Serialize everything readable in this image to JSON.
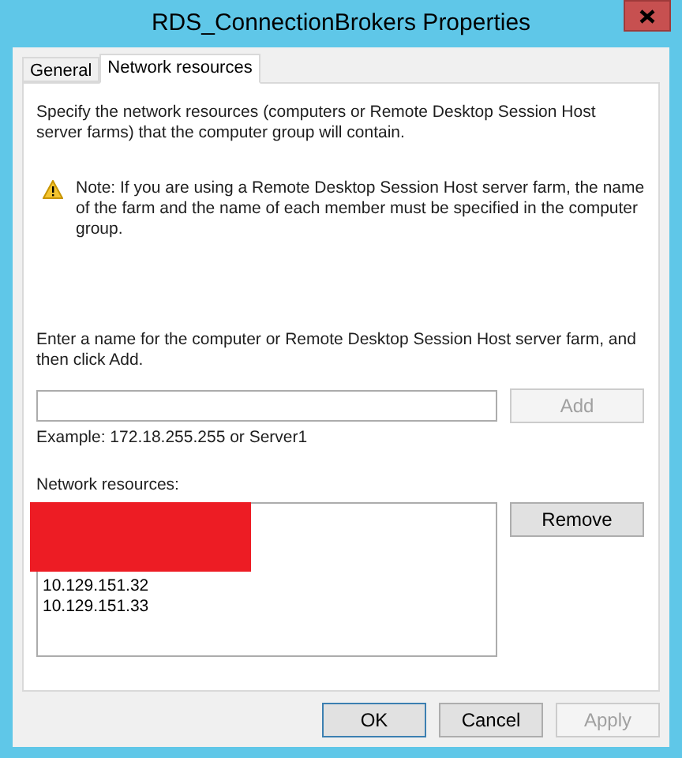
{
  "window": {
    "title": "RDS_ConnectionBrokers Properties"
  },
  "tabs": [
    {
      "label": "General",
      "selected": false
    },
    {
      "label": "Network resources",
      "selected": true
    }
  ],
  "description": "Specify the network resources (computers or Remote Desktop Session Host server farms) that the computer group will contain.",
  "note": "Note: If you are using a Remote Desktop Session Host server farm, the name of the farm and the name of each member must be specified in the computer group.",
  "entry": {
    "label": "Enter a name for the computer or Remote Desktop Session Host server farm, and then click Add.",
    "add_button": {
      "label": "Add",
      "disabled": true
    },
    "example": "Example: 172.18.255.255 or Server1"
  },
  "resources": {
    "label": "Network resources:",
    "items": [
      {
        "kind": "redacted"
      },
      {
        "kind": "text",
        "text": "10.129.151.32"
      },
      {
        "kind": "text",
        "text": "10.129.151.33"
      }
    ],
    "remove_button": {
      "label": "Remove",
      "disabled": false
    }
  },
  "buttons": [
    {
      "label": "OK",
      "default": true,
      "disabled": false
    },
    {
      "label": "Cancel",
      "default": false,
      "disabled": false
    },
    {
      "label": "Apply",
      "default": false,
      "disabled": true
    }
  ]
}
